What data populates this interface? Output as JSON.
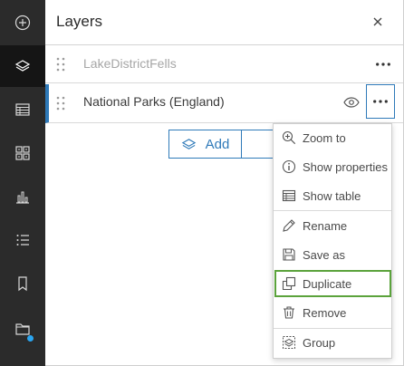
{
  "toolbar": {
    "items": [
      {
        "name": "add-icon"
      },
      {
        "name": "layers-icon",
        "active": true
      },
      {
        "name": "table-icon"
      },
      {
        "name": "basemap-gallery-icon"
      },
      {
        "name": "charts-icon"
      },
      {
        "name": "legend-icon"
      },
      {
        "name": "bookmarks-icon"
      },
      {
        "name": "folder-icon",
        "badge": true
      }
    ]
  },
  "panel": {
    "title": "Layers",
    "close_icon": "close-icon"
  },
  "layers": [
    {
      "name": "LakeDistrictFells",
      "visible": false
    },
    {
      "name": "National Parks (England)",
      "visible": true
    }
  ],
  "add_button": {
    "label": "Add"
  },
  "context_menu": {
    "items": [
      {
        "label": "Zoom to",
        "icon": "zoom-in-icon"
      },
      {
        "label": "Show properties",
        "icon": "info-icon"
      },
      {
        "label": "Show table",
        "icon": "table-icon"
      },
      {
        "label": "Rename",
        "icon": "pencil-icon"
      },
      {
        "label": "Save as",
        "icon": "save-icon"
      },
      {
        "label": "Duplicate",
        "icon": "duplicate-icon",
        "highlighted": true
      },
      {
        "label": "Remove",
        "icon": "trash-icon"
      },
      {
        "label": "Group",
        "icon": "group-icon"
      }
    ]
  },
  "colors": {
    "accent": "#2f7ab9",
    "highlight": "#5ba33c",
    "toolbar_bg": "#2b2b2b"
  }
}
